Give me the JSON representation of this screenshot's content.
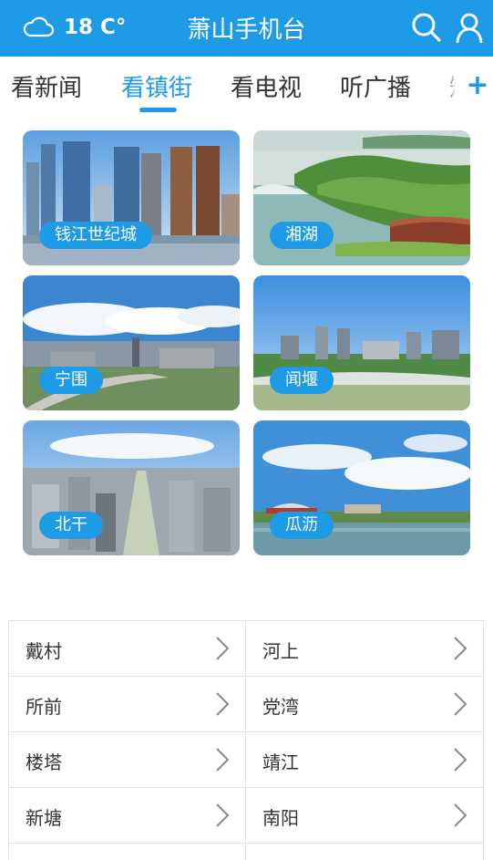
{
  "header": {
    "temperature": "18 C°",
    "title": "萧山手机台"
  },
  "tabs": [
    {
      "label": "看新闻",
      "active": false
    },
    {
      "label": "看镇街",
      "active": true
    },
    {
      "label": "看电视",
      "active": false
    },
    {
      "label": "听广播",
      "active": false
    },
    {
      "label": "短",
      "active": false
    }
  ],
  "add_tab_symbol": "+",
  "towns_featured": [
    {
      "label": "钱江世纪城"
    },
    {
      "label": "湘湖"
    },
    {
      "label": "宁围"
    },
    {
      "label": "闻堰"
    },
    {
      "label": "北干"
    },
    {
      "label": "瓜沥"
    }
  ],
  "towns_list": [
    {
      "label": "戴村"
    },
    {
      "label": "河上"
    },
    {
      "label": "所前"
    },
    {
      "label": "党湾"
    },
    {
      "label": "楼塔"
    },
    {
      "label": "靖江"
    },
    {
      "label": "新塘"
    },
    {
      "label": "南阳"
    }
  ],
  "colors": {
    "accent": "#1e9be7",
    "text": "#333333",
    "divider": "#e2e2e2"
  },
  "icons": {
    "weather": "cloud-icon",
    "search": "search-icon",
    "user": "user-icon",
    "chevron": "chevron-right-icon"
  }
}
